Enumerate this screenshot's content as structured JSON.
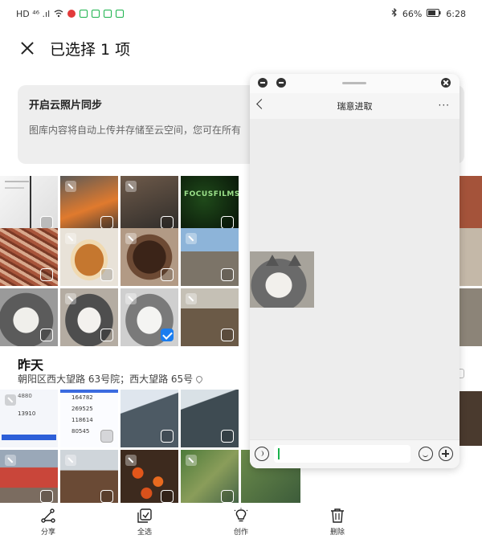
{
  "status": {
    "left": "HD ⁴⁶ .ıl",
    "battery": "66%",
    "time": "6:28"
  },
  "header": {
    "title": "已选择 1 项"
  },
  "cloud": {
    "title": "开启云照片同步",
    "desc": "图库内容将自动上传并存储至云空间，您可在所有"
  },
  "section": {
    "title": "昨天",
    "location": "朝阳区西大望路 63号院；西大望路 65号"
  },
  "bottom": {
    "share": "分享",
    "select_all": "全选",
    "create": "创作",
    "delete": "删除"
  },
  "float": {
    "title": "瑞意进取",
    "more": "···"
  },
  "thumb_texts": {
    "focus": "FOCUSFILMS",
    "phone1": "4880",
    "phone2": "13910",
    "stats1": "164782",
    "stats2": "269525",
    "stats3": "118614",
    "stats4": "80545"
  }
}
